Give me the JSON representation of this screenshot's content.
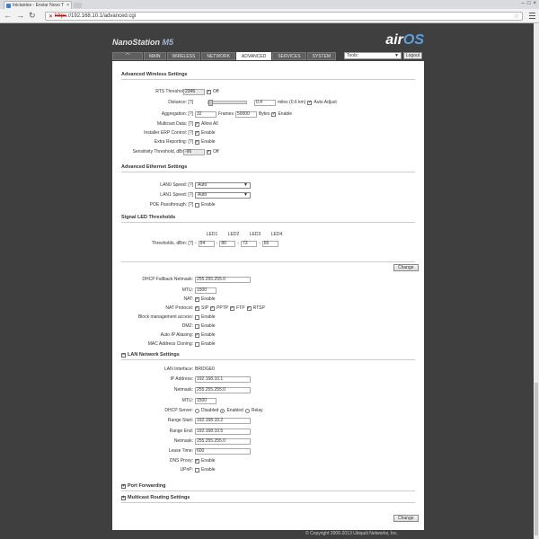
{
  "browser": {
    "tab_title": "Iniciantes - Enviar Novo T",
    "url_scheme": "https",
    "url_rest": "://192.168.10.1/advanced.cgi"
  },
  "header": {
    "model_prefix": "NanoStation",
    "model_suffix": "M5",
    "logo_air": "air",
    "logo_os": "OS"
  },
  "nav": {
    "tabs": [
      "MAIN",
      "WIRELESS",
      "NETWORK",
      "ADVANCED",
      "SERVICES",
      "SYSTEM"
    ],
    "active": "ADVANCED",
    "tools": "Tools:",
    "logout": "Logout"
  },
  "adv_wireless": {
    "title": "Advanced Wireless Settings",
    "rts_label": "RTS Threshold: [?]",
    "rts_value": "2346",
    "rts_off": "Off",
    "distance_label": "Distance: [?]",
    "distance_value": "0.4",
    "distance_units": "miles (0.6 km)",
    "auto_adjust": "Auto Adjust",
    "aggr_label": "Aggregation: [?]",
    "aggr_frames": "32",
    "frames": "Frames",
    "aggr_bytes": "50000",
    "bytes": "Bytes",
    "aggr_enable": "Enable",
    "multicast_label": "Multicast Data: [?]",
    "allow_all": "Allow All",
    "erp_label": "Installer ERP Control: [?]",
    "enable": "Enable",
    "extra_label": "Extra Reporting: [?]",
    "sens_label": "Sensitivity Threshold, dBm: [?]",
    "sens_value": "-96",
    "sens_off": "Off"
  },
  "adv_ethernet": {
    "title": "Advanced Ethernet Settings",
    "lan0_label": "LAN0 Speed: [?]",
    "lan0_value": "Auto",
    "lan1_label": "LAN1 Speed: [?]",
    "lan1_value": "Auto",
    "poe_label": "POE Passthrough: [?]",
    "enable": "Enable"
  },
  "led": {
    "title": "Signal LED Thresholds",
    "headers": [
      "LED1",
      "LED2",
      "LED3",
      "LED4"
    ],
    "label": "Thresholds, dBm: [?]",
    "values": [
      "94",
      "80",
      "73",
      "65"
    ],
    "minus": "-"
  },
  "change_label": "Change",
  "net": {
    "dhcp_fallback_label": "DHCP Fallback Netmask:",
    "dhcp_fallback_value": "255.255.255.0",
    "mtu_label": "MTU:",
    "mtu_value": "1500",
    "nat_label": "NAT:",
    "nat_protocol_label": "NAT Protocol:",
    "sip": "SIP",
    "pptp": "PPTP",
    "ftp": "FTP",
    "rtsp": "RTSP",
    "block_label": "Block management access:",
    "dmz_label": "DMZ:",
    "alias_label": "Auto IP Aliasing:",
    "clone_label": "MAC Address Cloning:",
    "enable": "Enable"
  },
  "lan": {
    "title": "LAN Network Settings",
    "iface_label": "LAN Interface:",
    "iface_value": "BRIDGE0",
    "ip_label": "IP Address:",
    "ip_value": "192.168.10.1",
    "netmask_label": "Netmask:",
    "netmask_value": "255.255.255.0",
    "mtu_label": "MTU:",
    "mtu_value": "1500",
    "dhcp_label": "DHCP Server:",
    "disabled": "Disabled",
    "enabled": "Enabled",
    "relay": "Relay",
    "range_start_label": "Range Start:",
    "range_start_value": "192.168.10.2",
    "range_end_label": "Range End:",
    "range_end_value": "192.168.10.5",
    "netmask2_label": "Netmask:",
    "netmask2_value": "255.255.255.0",
    "lease_label": "Lease Time:",
    "lease_value": "600",
    "dns_label": "DNS Proxy:",
    "upnp_label": "UPnP:",
    "enable": "Enable"
  },
  "collapsed": {
    "port_forwarding": "Port Forwarding",
    "multicast": "Multicast Routing Settings"
  },
  "footer": "© Copyright 2006-2013 Ubiquiti Networks, Inc.",
  "colors": {
    "page_bg": "#3f3f3f",
    "panel_bg": "#ffffff",
    "logo_blue": "#5aa0e0"
  }
}
